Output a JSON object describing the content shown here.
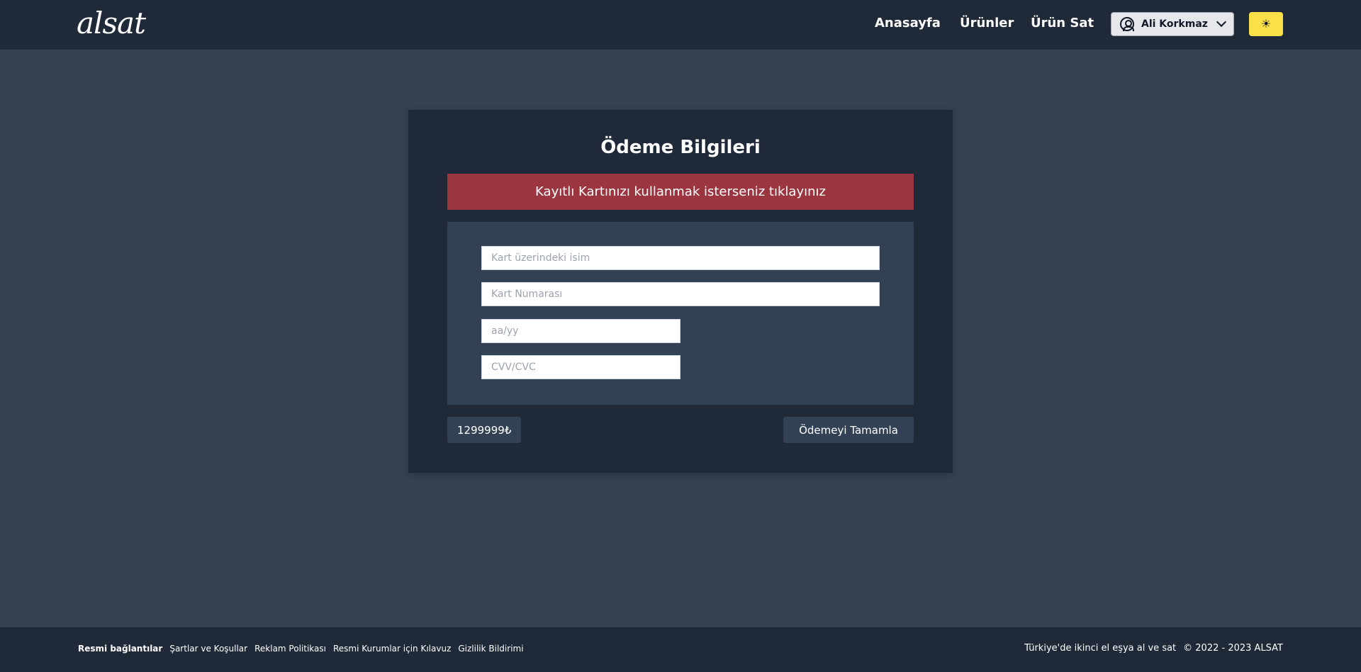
{
  "header": {
    "logo": "alsat",
    "nav": {
      "home": "Anasayfa",
      "products": "Ürünler",
      "sell": "Ürün Sat"
    },
    "user_name": "Ali Korkmaz",
    "theme_icon": "☀"
  },
  "payment": {
    "title": "Ödeme Bilgileri",
    "saved_card_banner": "Kayıtlı Kartınızı kullanmak isterseniz tıklayınız",
    "fields": {
      "name_placeholder": "Kart üzerindeki isim",
      "number_placeholder": "Kart Numarası",
      "expiry_placeholder": "aa/yy",
      "cvv_placeholder": "CVV/CVC"
    },
    "price": "1299999₺",
    "complete_button": "Ödemeyi Tamamla"
  },
  "footer": {
    "heading": "Resmi bağlantılar",
    "links": [
      "Şartlar ve Koşullar",
      "Reklam Politikası",
      "Resmi Kurumlar için Kılavuz",
      "Gizlilik Bildirimi"
    ],
    "tagline": "Türkiye'de ikinci el eşya al ve sat",
    "copyright": "© 2022 - 2023 ALSAT"
  },
  "colors": {
    "header_bg": "#1f2937",
    "page_bg": "#374151",
    "banner_bg": "#9b3540",
    "panel_bg": "#334155",
    "theme_button": "#fde047"
  }
}
